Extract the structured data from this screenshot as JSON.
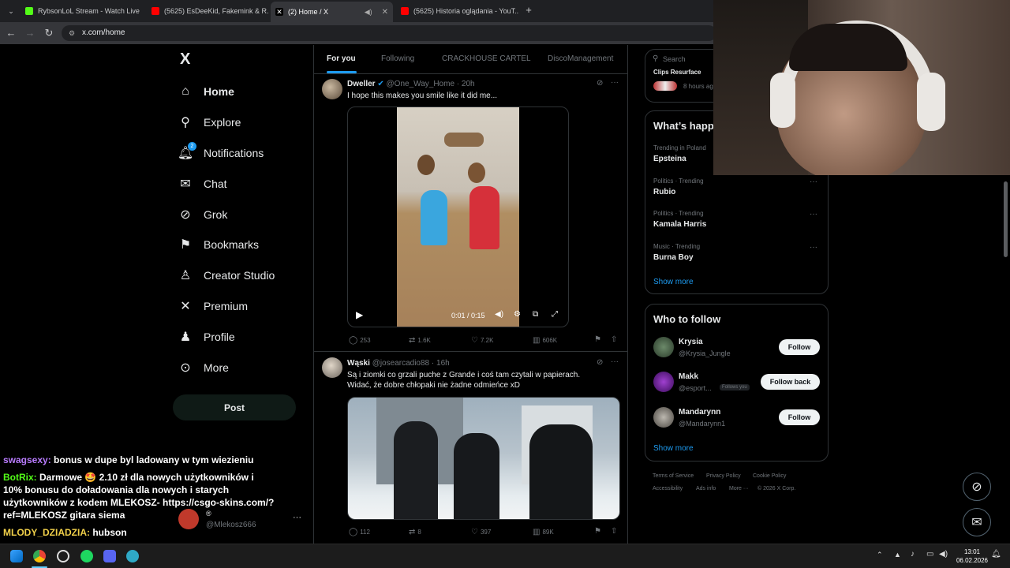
{
  "browser": {
    "tabs": [
      {
        "title": "RybsonLoL Stream - Watch Live",
        "color": "#53fc18"
      },
      {
        "title": "(5625) EsDeeKid, Fakemink & R...",
        "color": "#ff0000"
      },
      {
        "title": "(2) Home / X",
        "color": "#ffffff"
      },
      {
        "title": "(5625) Historia oglądania - YouT...",
        "color": "#ff0000"
      }
    ],
    "url": "x.com/home"
  },
  "nav": {
    "logo": "X",
    "items": [
      {
        "label": "Home",
        "icon": "home-icon",
        "glyph": "⌂"
      },
      {
        "label": "Explore",
        "icon": "search-icon",
        "glyph": "⚲"
      },
      {
        "label": "Notifications",
        "icon": "bell-icon",
        "glyph": "♫",
        "badge": "2"
      },
      {
        "label": "Chat",
        "icon": "mail-icon",
        "glyph": "✉"
      },
      {
        "label": "Grok",
        "icon": "grok-icon",
        "glyph": "⊘"
      },
      {
        "label": "Bookmarks",
        "icon": "bookmark-icon",
        "glyph": "⚑"
      },
      {
        "label": "Creator Studio",
        "icon": "creator-icon",
        "glyph": "♙"
      },
      {
        "label": "Premium",
        "icon": "x-logo-icon",
        "glyph": "✕"
      },
      {
        "label": "Profile",
        "icon": "person-icon",
        "glyph": "♟"
      },
      {
        "label": "More",
        "icon": "more-circle-icon",
        "glyph": "⊙"
      }
    ],
    "post_label": "Post",
    "account_handle": "@Mlekosz666",
    "account_name": "®"
  },
  "timeline": {
    "tabs": [
      "For you",
      "Following",
      "CRACKHOUSE CARTEL",
      "DiscoManagement"
    ],
    "posts": [
      {
        "name": "Dweller",
        "handle": "@One_Way_Home",
        "time": "20h",
        "text": [
          "I hope this makes you smile like it did me..."
        ],
        "video_time": "0:01 / 0:15",
        "replies": "253",
        "reposts": "1.6K",
        "likes": "7.2K",
        "views": "606K"
      },
      {
        "name": "Wąski",
        "handle": "@josearcadio88",
        "time": "16h",
        "text": [
          "Są i ziomki co grzali puche z Grande i coś tam czytali w papierach.",
          "Widać, że dobre chłopaki nie żadne odmieńce xD"
        ],
        "replies": "112",
        "reposts": "8",
        "likes": "397",
        "views": "89K"
      }
    ]
  },
  "sidebar": {
    "search_placeholder": "Search",
    "top_item": "Clips Resurface",
    "top_item_time": "8 hours ag",
    "happening_title": "What’s happ",
    "trends": [
      {
        "context": "Trending in Poland",
        "name": "Epsteina"
      },
      {
        "context": "Politics · Trending",
        "name": "Rubio"
      },
      {
        "context": "Politics · Trending",
        "name": "Kamala Harris"
      },
      {
        "context": "Music · Trending",
        "name": "Burna Boy"
      }
    ],
    "show_more": "Show more",
    "who_to_follow_title": "Who to follow",
    "follow": [
      {
        "name": "Krysia",
        "handle": "@Krysia_Jungle",
        "button": "Follow"
      },
      {
        "name": "Makk",
        "handle": "@esport...",
        "badge": "Follows you",
        "button": "Follow back"
      },
      {
        "name": "Mandarynn",
        "handle": "@Mandarynn1",
        "button": "Follow"
      }
    ],
    "show_more_follow": "Show more",
    "footer": [
      "Terms of Service",
      "Privacy Policy",
      "Cookie Policy",
      "Accessibility",
      "Ads info",
      "More ···",
      "© 2026 X Corp."
    ]
  },
  "chat": [
    {
      "user": "swagsexy:",
      "color": "#b97cff",
      "message": "bonus w dupe byl ladowany w tym wiezieniu"
    },
    {
      "user": "BotRix:",
      "color": "#53fc18",
      "message": "Darmowe 🤩 2.10 zł dla nowych użytkowników i"
    },
    {
      "user": "",
      "color": "#fff",
      "message": "10% bonusu do doładowania dla nowych i starych"
    },
    {
      "user": "",
      "color": "#fff",
      "message": "użytkowników z kodem MLEKOSZ- https://csgo-skins.com/?"
    },
    {
      "user": "",
      "color": "#fff",
      "message": "ref=MLEKOSZ gitara siema"
    },
    {
      "user": "MLODY_DZIADZIA:",
      "color": "#f2d14a",
      "message": "hubson"
    }
  ],
  "taskbar": {
    "time": "13:01",
    "date": "06.02.2026"
  }
}
